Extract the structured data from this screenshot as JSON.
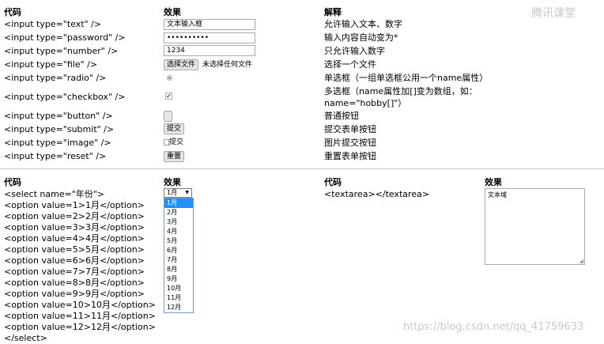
{
  "headers": {
    "code": "代码",
    "effect": "效果",
    "explain": "解释"
  },
  "rows": [
    {
      "code": "<input type=\"text\" />",
      "explain": "允许输入文本、数字"
    },
    {
      "code": "<input type=\"password\" />",
      "explain": "输入内容自动变为*"
    },
    {
      "code": "<input type=\"number\" />",
      "explain": "只允许输入数字"
    },
    {
      "code": "<input type=\"file\" />",
      "explain": "选择一个文件"
    },
    {
      "code": "<input type=\"radio\" />",
      "explain": "单选框（一组单选框公用一个name属性）"
    },
    {
      "code": "<input type=\"checkbox\" />",
      "explain": "多选框（name属性加[]变为数组，如：",
      "explain2": "name=\"hobby[]\"）"
    },
    {
      "code": "<input type=\"button\" />",
      "explain": "普通按钮"
    },
    {
      "code": "<input type=\"submit\" />",
      "explain": "提交表单按钮"
    },
    {
      "code": "<input type=\"image\" />",
      "explain": "图片提交按钮"
    },
    {
      "code": "<input type=\"reset\" />",
      "explain": "重置表单按钮"
    }
  ],
  "effects": {
    "text_value": "文本输入框",
    "password_value": "••••••••••",
    "number_value": "1234",
    "file_button": "选择文件",
    "file_status": "未选择任何文件",
    "submit_label": "提交",
    "image_alt": "提交",
    "reset_label": "重置"
  },
  "bottom": {
    "code_header": "代码",
    "effect_header": "效果",
    "code_header2": "代码",
    "effect_header2": "效果",
    "select_code": [
      "<select name=\"年份\">",
      "<option value=1>1月</option>",
      "<option value=2>2月</option>",
      "<option value=3>3月</option>",
      "<option value=4>4月</option>",
      "<option value=5>5月</option>",
      "<option value=6>6月</option>",
      "<option value=7>7月</option>",
      "<option value=8>8月</option>",
      "<option value=9>9月</option>",
      "<option value=10>10月</option>",
      "<option value=11>11月</option>",
      "<option value=12>12月</option>",
      "</select>"
    ],
    "select_value": "1月",
    "options": [
      "1月",
      "2月",
      "3月",
      "4月",
      "5月",
      "6月",
      "7月",
      "8月",
      "9月",
      "10月",
      "11月",
      "12月"
    ],
    "textarea_code": "<textarea></textarea>",
    "textarea_value": "文本域"
  },
  "watermarks": {
    "top_right": "腾讯课堂",
    "bottom_right": "https://blog.csdn.net/qq_41759633"
  }
}
